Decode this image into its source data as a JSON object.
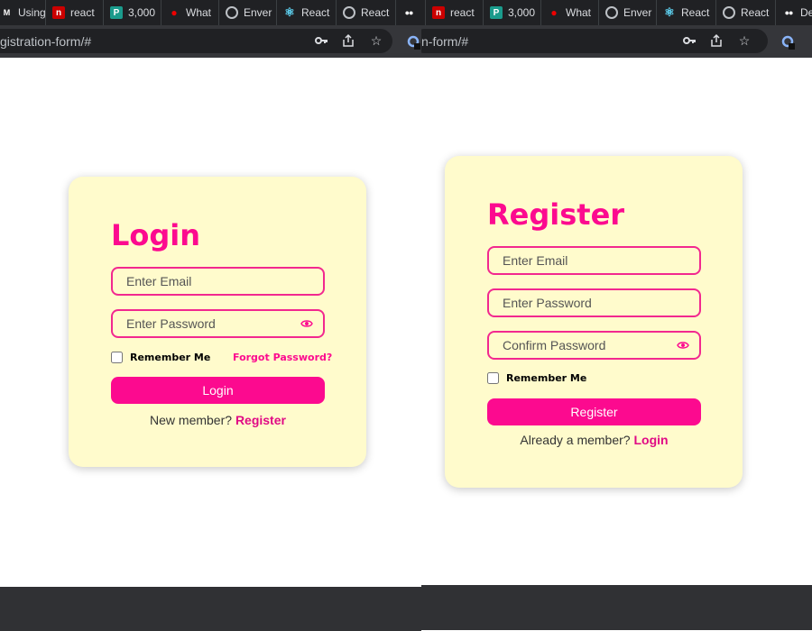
{
  "left_window": {
    "tabs": [
      {
        "label": "Using",
        "icon": "medium-icon"
      },
      {
        "label": "react",
        "icon": "npm-icon"
      },
      {
        "label": "3,000",
        "icon": "p-icon"
      },
      {
        "label": "What",
        "icon": "redhat-icon"
      },
      {
        "label": "Enver",
        "icon": "globe-icon"
      },
      {
        "label": "React",
        "icon": "react-icon"
      },
      {
        "label": "React",
        "icon": "globe-icon"
      }
    ],
    "url": "gistration-form/#",
    "taskbar_color": "#303134"
  },
  "right_window": {
    "tabs": [
      {
        "label": "react",
        "icon": "npm-icon"
      },
      {
        "label": "3,000",
        "icon": "p-icon"
      },
      {
        "label": "What",
        "icon": "redhat-icon"
      },
      {
        "label": "Enver",
        "icon": "globe-icon"
      },
      {
        "label": "React",
        "icon": "react-icon"
      },
      {
        "label": "React",
        "icon": "globe-icon"
      },
      {
        "label": "De",
        "icon": "medium-icon"
      }
    ],
    "url": "n-form/#"
  },
  "login": {
    "title": "Login",
    "email_placeholder": "Enter Email",
    "password_placeholder": "Enter Password",
    "remember_label": "Remember Me",
    "forgot_label": "Forgot Password?",
    "button_label": "Login",
    "switch_text": "New member?",
    "switch_link": "Register"
  },
  "register": {
    "title": "Register",
    "email_placeholder": "Enter Email",
    "password_placeholder": "Enter Password",
    "confirm_placeholder": "Confirm Password",
    "remember_label": "Remember Me",
    "button_label": "Register",
    "switch_text": "Already a member?",
    "switch_link": "Login"
  },
  "colors": {
    "accent": "#fc0a8f",
    "card_bg": "#fffbcc",
    "chrome_dark": "#202124",
    "chrome_bar": "#35363a"
  }
}
